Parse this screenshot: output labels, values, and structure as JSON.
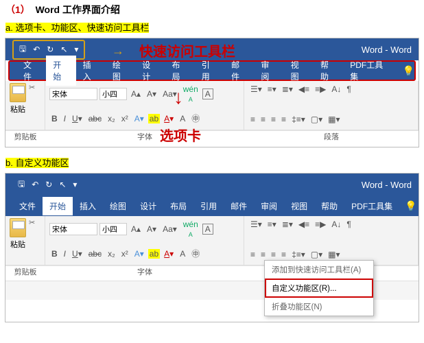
{
  "doc": {
    "title_prefix": "（1）",
    "title": "Word 工作界面介绍",
    "section_a": "a.  选项卡、功能区、快速访问工具栏",
    "section_b": "b.  自定义功能区"
  },
  "app_title": "Word  -  Word",
  "annotations": {
    "qat": "快速访问工具栏",
    "tabs": "选项卡"
  },
  "tabs": {
    "file": "文件",
    "home": "开始",
    "insert": "插入",
    "draw": "绘图",
    "design": "设计",
    "layout": "布局",
    "references": "引用",
    "mailings": "邮件",
    "review": "审阅",
    "view": "视图",
    "help": "帮助",
    "pdf": "PDF工具集"
  },
  "ribbon": {
    "paste": "粘贴",
    "font_name": "宋体",
    "font_size": "小四",
    "clipboard": "剪贴板",
    "font": "字体",
    "paragraph": "段落"
  },
  "context_menu": {
    "add_qat": "添加到快速访问工具栏(A)",
    "customize": "自定义功能区(R)...",
    "collapse": "折叠功能区(N)"
  }
}
